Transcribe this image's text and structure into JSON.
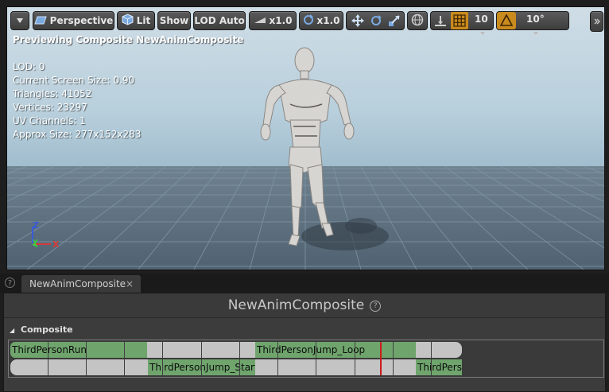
{
  "viewport": {
    "toolbar": {
      "perspective_label": "Perspective",
      "lit_label": "Lit",
      "show_label": "Show",
      "lod_label": "LOD Auto",
      "speed1_label": "x1.0",
      "speed2_label": "x1.0",
      "grid_value": "10",
      "angle_value": "10°"
    },
    "stats": {
      "title": "Previewing Composite NewAnimComposite",
      "lines": [
        "LOD: 0",
        "Current Screen Size: 0.90",
        "Triangles: 41052",
        "Vertices: 23297",
        "UV Channels: 1",
        "Approx Size: 277x152x283"
      ]
    },
    "axis": {
      "z": "Z",
      "y": "Y",
      "x": "X"
    }
  },
  "tabs": {
    "doc_tab_label": "NewAnimComposite",
    "close_glyph": "×",
    "help_glyph": "?"
  },
  "editor": {
    "title": "NewAnimComposite",
    "help_glyph": "?",
    "section_label": "Composite",
    "section_arrow": "◢",
    "track_labels": [
      "ThirdPersonRun",
      "ThirdPersonJump_Loop",
      "ThirdPersonJump_Start",
      "ThirdPersonJump_End"
    ]
  },
  "colors": {
    "segment_green": "#6fa56d",
    "segment_grey": "#c4c4c4",
    "playhead": "#cc1b1b",
    "snap_accent": "#c98a1e"
  }
}
